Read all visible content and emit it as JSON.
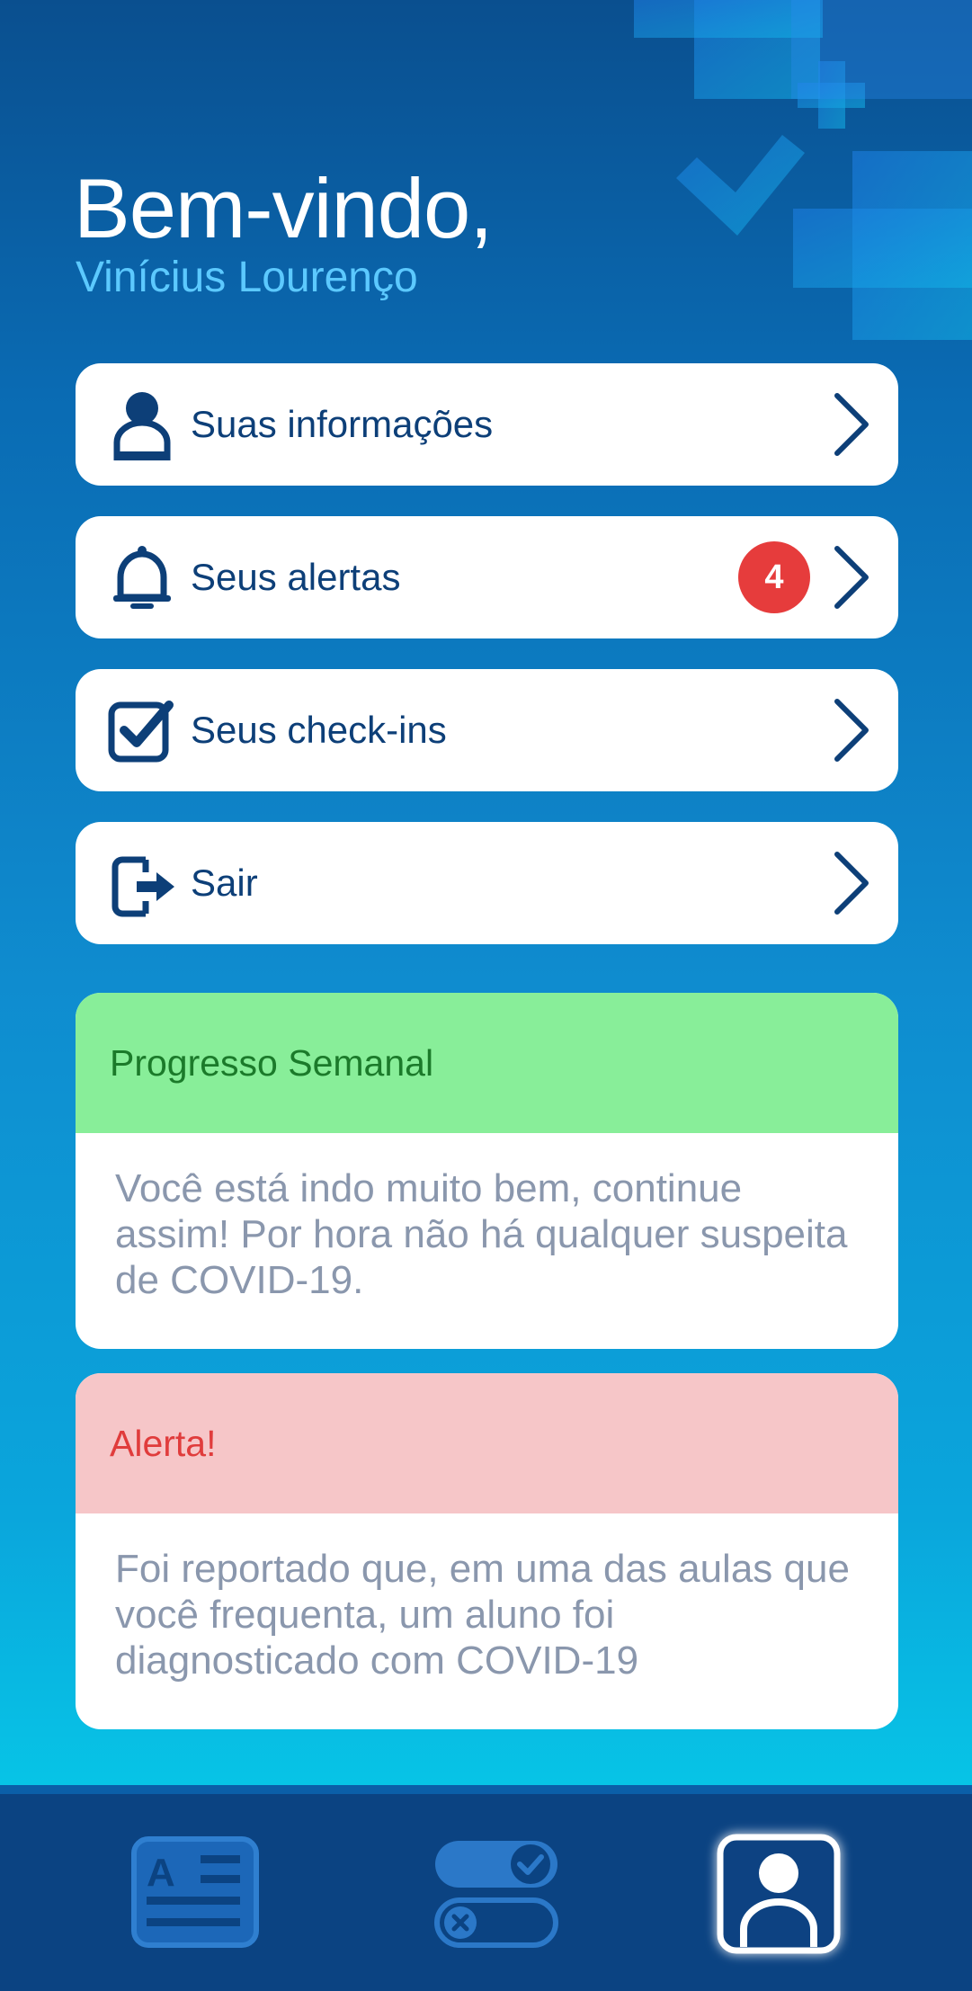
{
  "header": {
    "greeting": "Bem-vindo,",
    "user_name": "Vinícius Lourenço"
  },
  "menu": {
    "items": [
      {
        "label": "Suas informações",
        "icon": "person-icon"
      },
      {
        "label": "Seus alertas",
        "icon": "bell-icon",
        "badge": "4"
      },
      {
        "label": "Seus check-ins",
        "icon": "checkbox-icon"
      },
      {
        "label": "Sair",
        "icon": "logout-icon"
      }
    ]
  },
  "cards": {
    "progress": {
      "title": "Progresso Semanal",
      "body": "Você está indo muito bem, continue assim! Por hora não há qualquer suspeita de COVID-19."
    },
    "alert": {
      "title": "Alerta!",
      "body": "Foi reportado que, em uma das aulas que você frequenta, um aluno foi diagnosticado com COVID-19"
    }
  },
  "bottom_nav": {
    "tabs": [
      {
        "icon": "id-card-icon",
        "active": false
      },
      {
        "icon": "toggle-checkin-icon",
        "active": false
      },
      {
        "icon": "profile-icon",
        "active": true
      }
    ]
  },
  "colors": {
    "brand_dark": "#0b4382",
    "menu_text": "#0d3f78",
    "badge": "#e63c3c",
    "progress_header": "#88ee99",
    "progress_title": "#1b7a2a",
    "alert_header": "#f6c6c8",
    "alert_title": "#e03c3c",
    "body_text": "#8a97ad",
    "username": "#5cc9ff"
  }
}
